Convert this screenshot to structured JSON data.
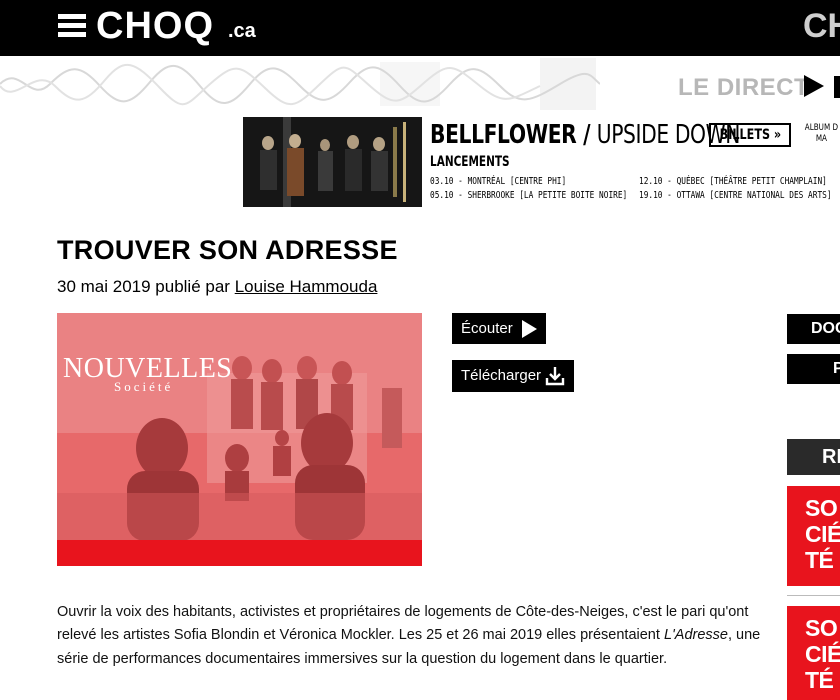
{
  "site": {
    "logo": "CHOQ",
    "logo_suffix": ".ca",
    "top_right": "CH"
  },
  "live": {
    "label": "LE DIRECT"
  },
  "ad": {
    "artist": "BELLFLOWER",
    "separator": " / ",
    "album": "UPSIDE DOWN",
    "button": "BILLETS",
    "button_arrow": "»",
    "side_line1": "ALBUM D",
    "side_line2": "MA",
    "subtitle": "LANCEMENTS",
    "dates": [
      "03.10 - MONTRÉAL [CENTRE PHI]",
      "05.10 - SHERBROOKE [LA PETITE BOITE NOIRE]",
      "12.10 - QUÉBEC [THÉÂTRE PETIT CHAMPLAIN]",
      "19.10 - OTTAWA [CENTRE NATIONAL DES ARTS]"
    ]
  },
  "article": {
    "title": "TROUVER SON ADRESSE",
    "date_published": "30 mai 2019 publié par",
    "author": "Louise Hammouda",
    "image_brand_line1": "NOUVELLES",
    "image_brand_line2": "Société",
    "body_part1": "Ouvrir la voix des habitants, activistes et propriétaires de logements de Côte-des-Neiges, c'est le pari qu'ont relevé les artistes Sofia Blondin et Véronica Mockler. Les 25 et 26 mai 2019 elles présentaient ",
    "body_italic": "L'Adresse",
    "body_part2": ", une série de performances documentaires immersives sur la question du logement dans le quartier."
  },
  "actions": {
    "listen": "Écouter",
    "download": "Télécharger"
  },
  "sidebar": {
    "doc_button": "DOC",
    "p_button": "P",
    "section_header": "RE",
    "card1": [
      "SO",
      "CIÉ",
      "TÉ"
    ],
    "card2": [
      "SO",
      "CIÉ",
      "TÉ"
    ]
  },
  "colors": {
    "brand_red": "#e8141d",
    "hero_tint": "#e86a6b",
    "topbar": "#000000"
  }
}
